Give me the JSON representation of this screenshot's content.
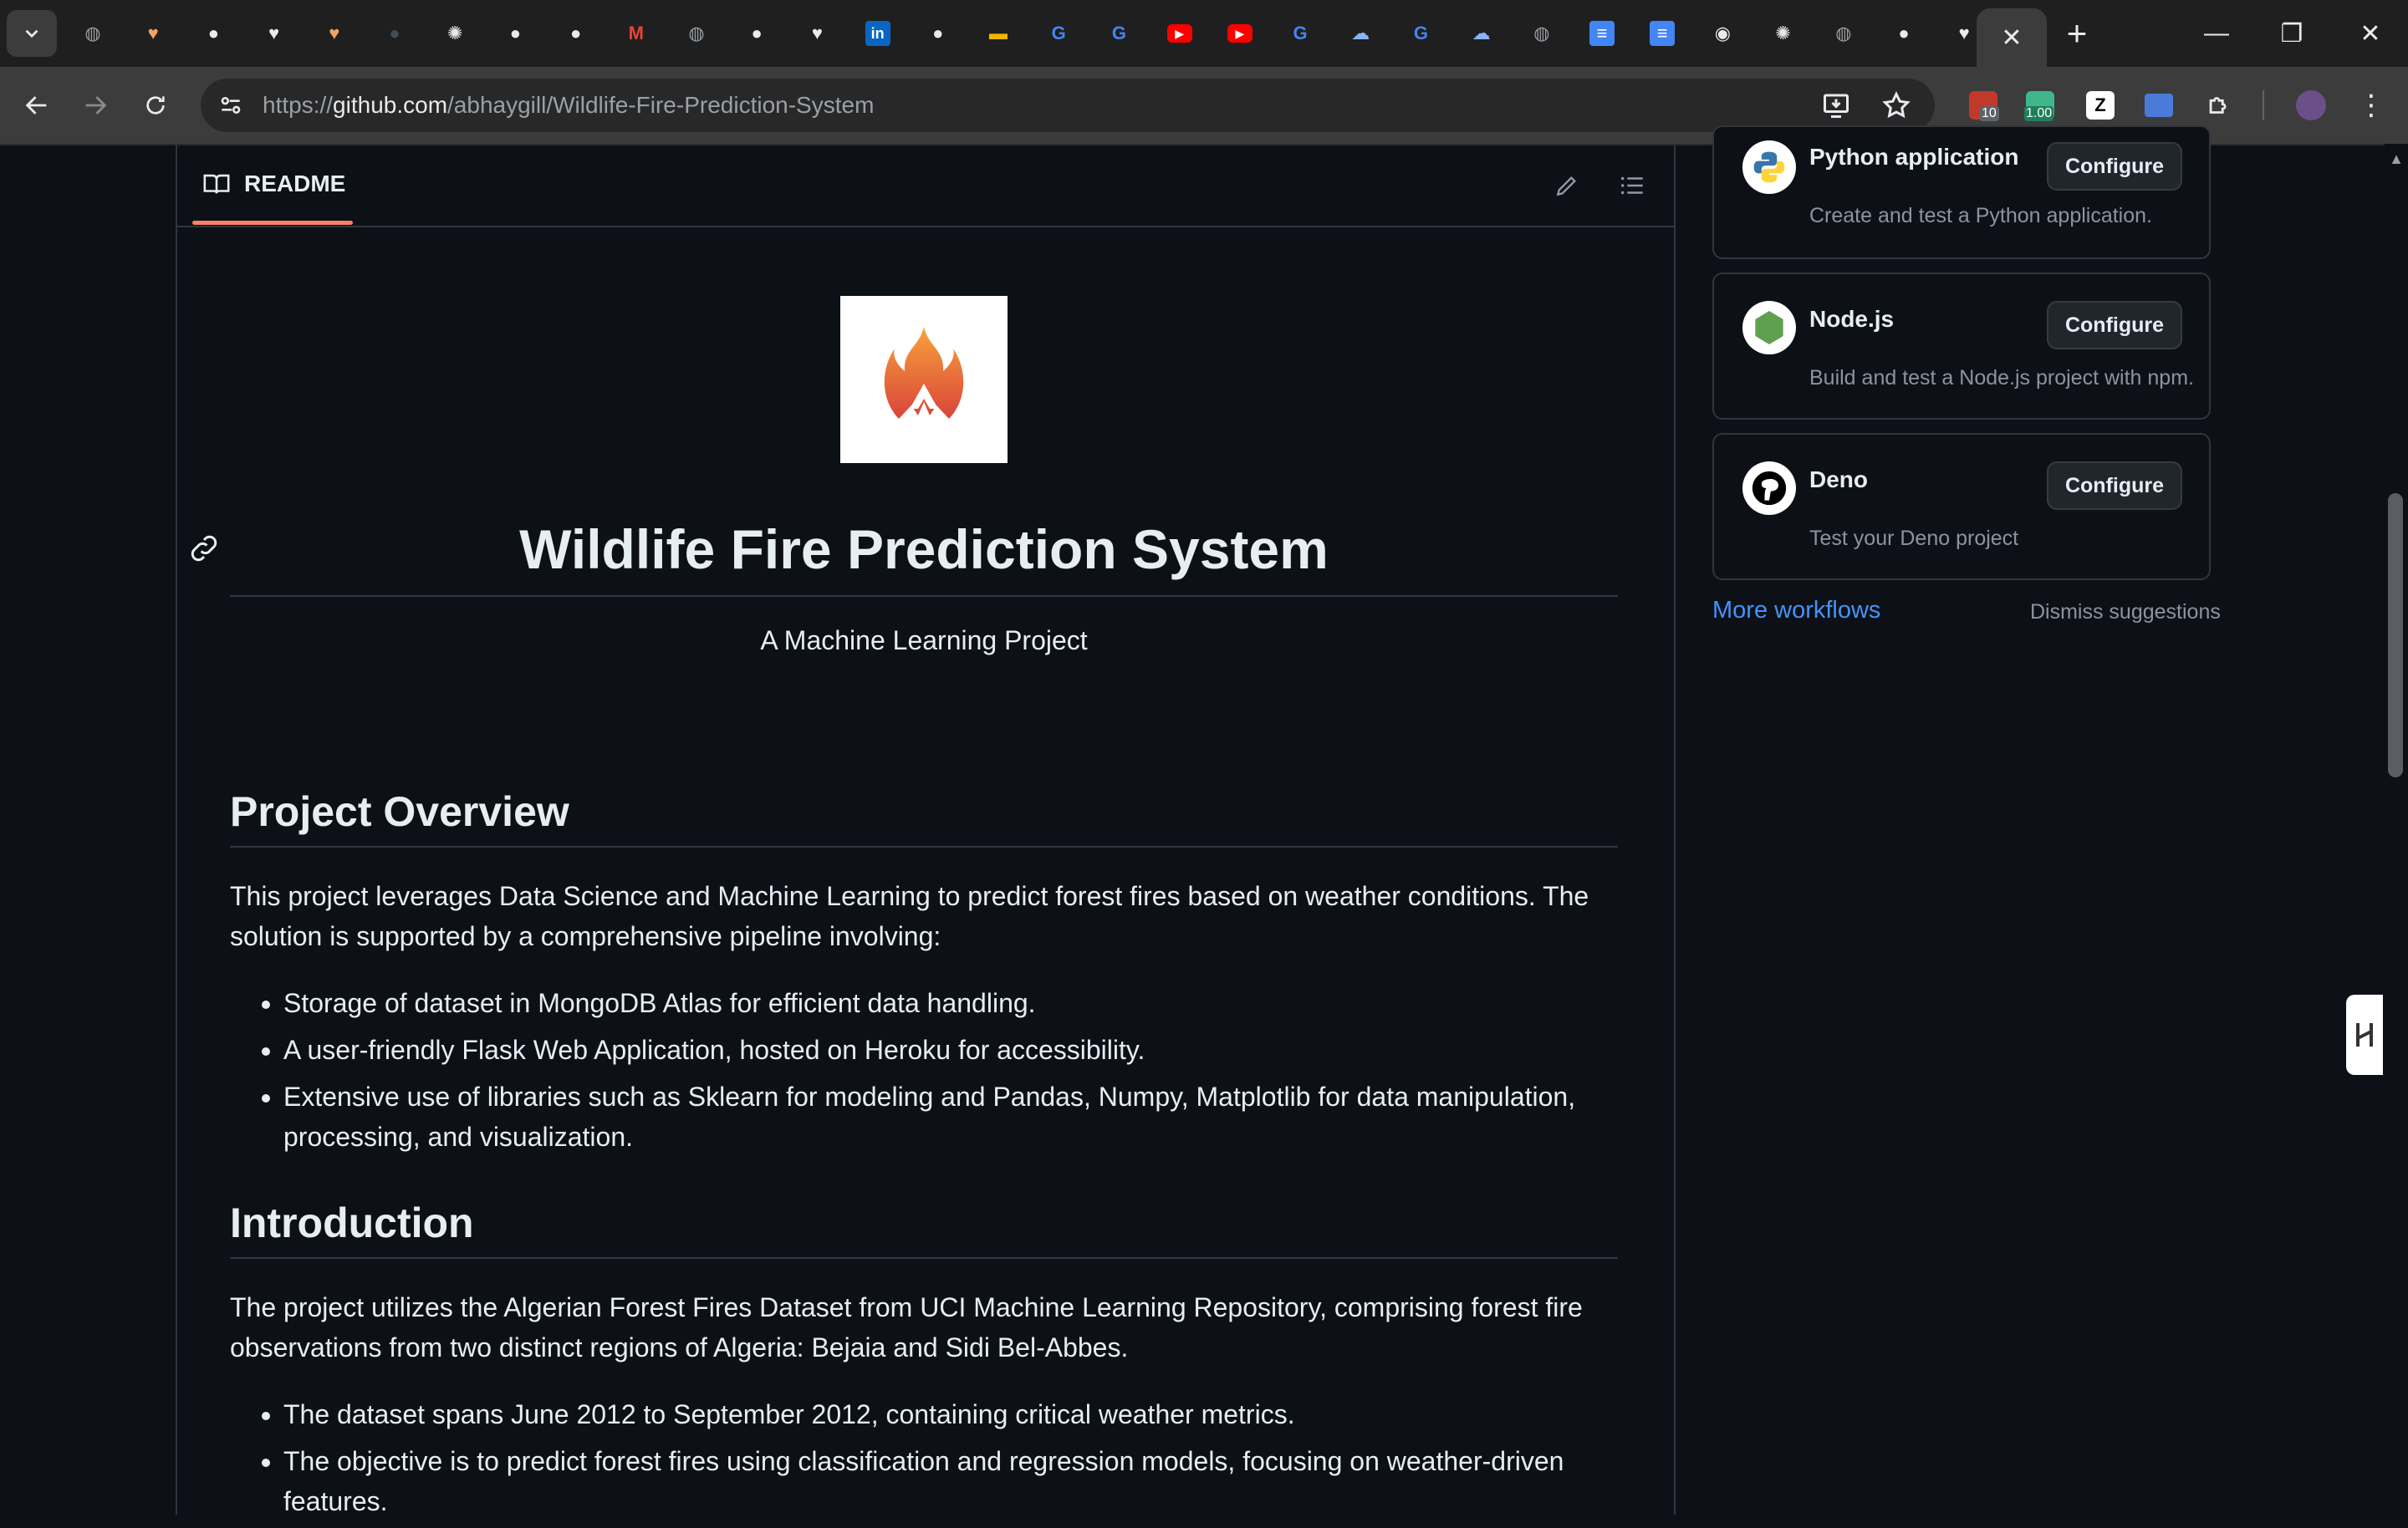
{
  "browser": {
    "url_prefix": "https://",
    "url_domain": "github.com",
    "url_path": "/abhaygill/Wildlife-Fire-Prediction-System",
    "tabs": [
      {
        "icon": "globe-icon",
        "color": "#9aa0a6"
      },
      {
        "icon": "heart-colorful-icon",
        "color": "#f4a261"
      },
      {
        "icon": "github-icon",
        "color": "#e8eaed"
      },
      {
        "icon": "heart-icon",
        "color": "#e8eaed"
      },
      {
        "icon": "heart-colorful-icon",
        "color": "#f4a261"
      },
      {
        "icon": "github-icon",
        "color": "#444c56"
      },
      {
        "icon": "openai-icon",
        "color": "#e8eaed"
      },
      {
        "icon": "github-icon",
        "color": "#e8eaed"
      },
      {
        "icon": "github-icon",
        "color": "#e8eaed"
      },
      {
        "icon": "gmail-icon",
        "color": "#ea4335"
      },
      {
        "icon": "globe-icon",
        "color": "#9aa0a6"
      },
      {
        "icon": "github-icon",
        "color": "#e8eaed"
      },
      {
        "icon": "heart-icon",
        "color": "#e8eaed"
      },
      {
        "icon": "linkedin-icon",
        "color": "#0a66c2"
      },
      {
        "icon": "github-icon",
        "color": "#e8eaed"
      },
      {
        "icon": "slides-icon",
        "color": "#f4b400"
      },
      {
        "icon": "google-icon",
        "color": "#4285f4"
      },
      {
        "icon": "google-icon",
        "color": "#4285f4"
      },
      {
        "icon": "youtube-icon",
        "color": "#ff0000"
      },
      {
        "icon": "youtube-icon",
        "color": "#ff0000"
      },
      {
        "icon": "google-icon",
        "color": "#4285f4"
      },
      {
        "icon": "cloud-icon",
        "color": "#8ab4f8"
      },
      {
        "icon": "google-icon",
        "color": "#4285f4"
      },
      {
        "icon": "cloud-icon",
        "color": "#8ab4f8"
      },
      {
        "icon": "globe-icon",
        "color": "#9aa0a6"
      },
      {
        "icon": "docs-icon",
        "color": "#4285f4"
      },
      {
        "icon": "docs-icon",
        "color": "#4285f4"
      },
      {
        "icon": "chrome-icon",
        "color": "#e8eaed"
      },
      {
        "icon": "openai-icon",
        "color": "#e8eaed"
      },
      {
        "icon": "globe-icon",
        "color": "#9aa0a6"
      },
      {
        "icon": "github-icon",
        "color": "#e8eaed"
      },
      {
        "icon": "heart-icon",
        "color": "#e8eaed"
      }
    ],
    "extensions": {
      "badge_1": "10",
      "badge_2": "1.00"
    }
  },
  "readme": {
    "tab_label": "README",
    "title": "Wildlife Fire Prediction System",
    "subtitle": "A Machine Learning Project",
    "overview": {
      "heading": "Project Overview",
      "text": "This project leverages Data Science and Machine Learning to predict forest fires based on weather conditions. The solution is supported by a comprehensive pipeline involving:",
      "bullets": [
        "Storage of dataset in MongoDB Atlas for efficient data handling.",
        "A user-friendly Flask Web Application, hosted on Heroku for accessibility.",
        "Extensive use of libraries such as Sklearn for modeling and Pandas, Numpy, Matplotlib for data manipulation, processing, and visualization."
      ]
    },
    "introduction": {
      "heading": "Introduction",
      "text": "The project utilizes the Algerian Forest Fires Dataset from UCI Machine Learning Repository, comprising forest fire observations from two distinct regions of Algeria: Bejaia and Sidi Bel-Abbes.",
      "bullets": [
        "The dataset spans June 2012 to September 2012, containing critical weather metrics.",
        "The objective is to predict forest fires using classification and regression models, focusing on weather-driven features."
      ]
    }
  },
  "sidebar": {
    "workflows": [
      {
        "name": "Python application",
        "desc": "Create and test a Python application.",
        "button": "Configure"
      },
      {
        "name": "Node.js",
        "desc": "Build and test a Node.js project with npm.",
        "button": "Configure"
      },
      {
        "name": "Deno",
        "desc": "Test your Deno project",
        "button": "Configure"
      }
    ],
    "more_workflows": "More workflows",
    "dismiss": "Dismiss suggestions"
  }
}
